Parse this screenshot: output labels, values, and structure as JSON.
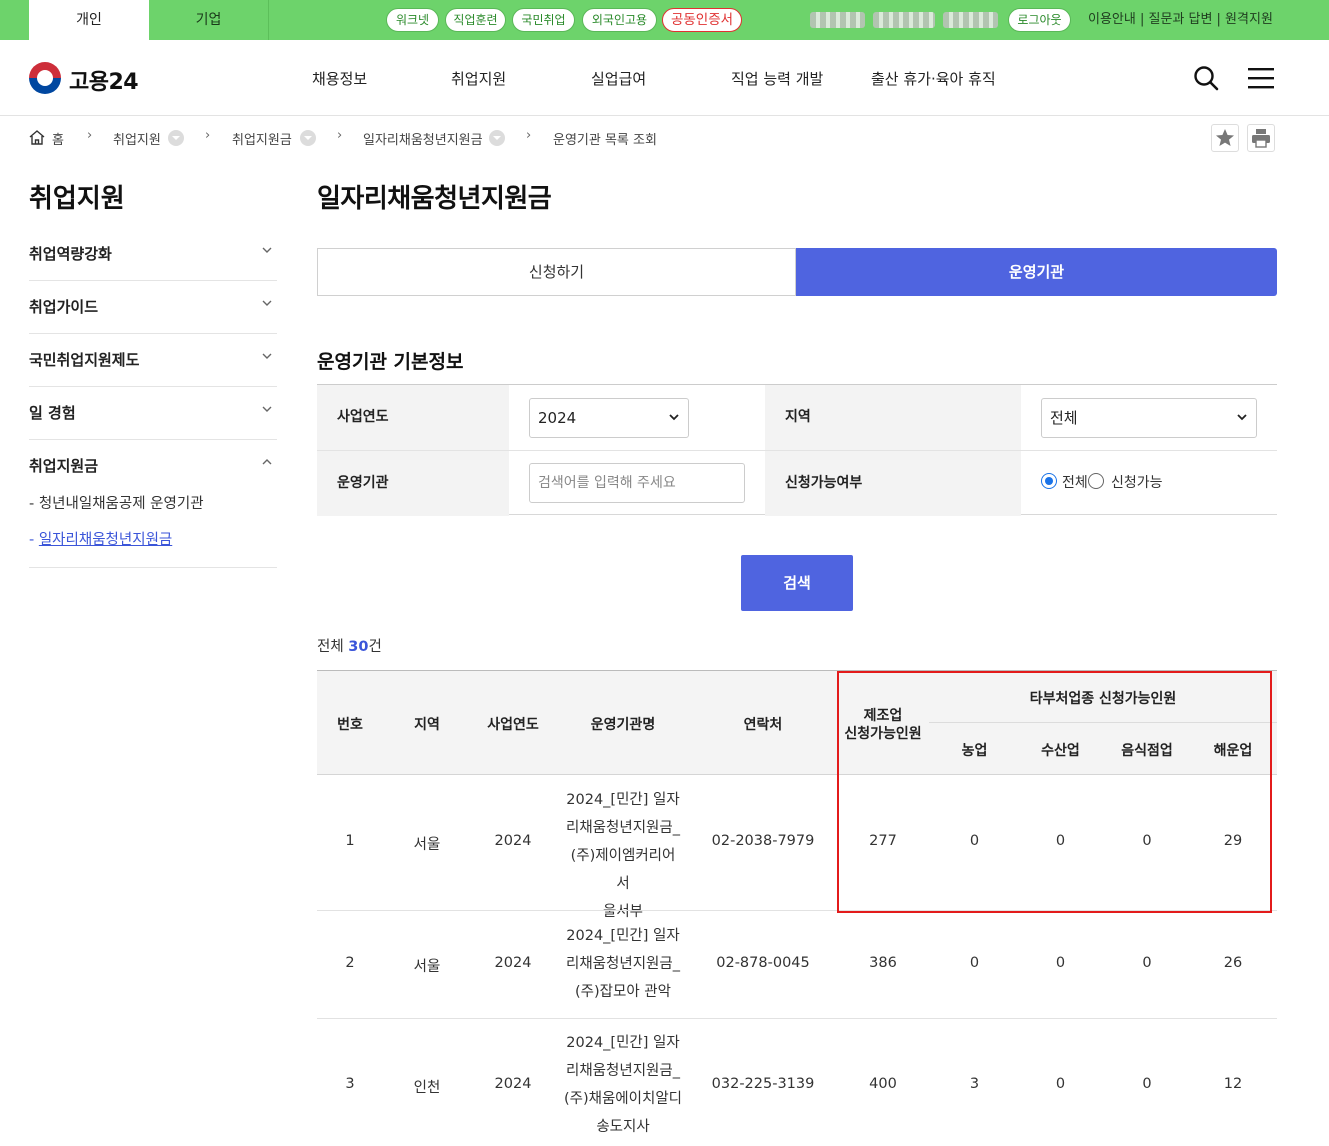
{
  "topbar": {
    "tab_personal": "개인",
    "tab_company": "기업",
    "quick_links": [
      "워크넷",
      "직업훈련",
      "국민취업",
      "외국인고용",
      "공동인증서"
    ],
    "logout": "로그아웃",
    "util_links": "이용안내 | 질문과 답변 | 원격지원"
  },
  "header": {
    "logo": "고용24",
    "nav": [
      "채용정보",
      "취업지원",
      "실업급여",
      "직업 능력 개발",
      "출산 휴가·육아 휴직"
    ]
  },
  "breadcrumb": [
    "홈",
    "취업지원",
    "취업지원금",
    "일자리채움청년지원금",
    "운영기관 목록 조회"
  ],
  "sidebar": {
    "title": "취업지원",
    "items": [
      "취업역량강화",
      "취업가이드",
      "국민취업지원제도",
      "일 경험",
      "취업지원금"
    ],
    "sub_items": [
      "- 청년내일채움공제 운영기관",
      "일자리채움청년지원금"
    ],
    "sub_prefix": "- "
  },
  "main": {
    "title": "일자리채움청년지원금",
    "tab_apply": "신청하기",
    "tab_operators": "운영기관",
    "section_title": "운영기관 기본정보",
    "form": {
      "year_label": "사업연도",
      "year_value": "2024",
      "region_label": "지역",
      "region_value": "전체",
      "org_label": "운영기관",
      "org_placeholder": "검색어를 입력해 주세요",
      "avail_label": "신청가능여부",
      "radio_all": "전체",
      "radio_avail": "신청가능"
    },
    "search_button": "검색",
    "total_prefix": "전체 ",
    "total_count": "30",
    "total_suffix": "건"
  },
  "table": {
    "headers": {
      "no": "번호",
      "region": "지역",
      "year": "사업연도",
      "org": "운영기관명",
      "contact": "연락처",
      "mfg_line1": "제조업",
      "mfg_line2": "신청가능인원",
      "other_group": "타부처업종 신청가능인원",
      "agri": "농업",
      "fish": "수산업",
      "food": "음식점업",
      "ship": "해운업"
    },
    "rows": [
      {
        "no": "1",
        "region": "서울",
        "year": "2024",
        "org_lines": [
          "2024_[민간] 일자",
          "리채움청년지원금_",
          "(주)제이엠커리어 서",
          "울서부"
        ],
        "contact": "02-2038-7979",
        "mfg": "277",
        "agri": "0",
        "fish": "0",
        "food": "0",
        "ship": "29"
      },
      {
        "no": "2",
        "region": "서울",
        "year": "2024",
        "org_lines": [
          "2024_[민간] 일자",
          "리채움청년지원금_",
          "(주)잡모아 관악"
        ],
        "contact": "02-878-0045",
        "mfg": "386",
        "agri": "0",
        "fish": "0",
        "food": "0",
        "ship": "26"
      },
      {
        "no": "3",
        "region": "인천",
        "year": "2024",
        "org_lines": [
          "2024_[민간] 일자",
          "리채움청년지원금_",
          "(주)채움에이치알디",
          "송도지사"
        ],
        "contact": "032-225-3139",
        "mfg": "400",
        "agri": "3",
        "fish": "0",
        "food": "0",
        "ship": "12"
      }
    ]
  },
  "colors": {
    "green": "#6dd36b",
    "blue": "#4f64e0",
    "highlight_red": "#e31b1b"
  }
}
